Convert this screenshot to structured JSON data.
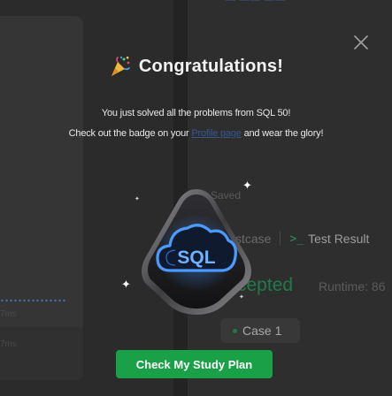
{
  "modal": {
    "title": "Congratulations!",
    "message_line1": "You just solved all the problems from SQL 50!",
    "message_line2_before": "Check out the badge on your",
    "profile_link_text": "Profile page",
    "message_line2_after": "and wear the glory!",
    "badge_text": "SQL",
    "cta_label": "Check My Study Plan",
    "icons": {
      "title_icon": "party-popper-icon",
      "close_icon": "close-icon",
      "badge_icon": "cloud-icon"
    },
    "colors": {
      "cta_background": "#1aa147",
      "badge_accent": "#3f8fff",
      "link": "#3d7be0"
    }
  },
  "background": {
    "saved_label": "Saved",
    "testcase_tab": "stcase",
    "test_result_tab": "Test Result",
    "test_result_icon": "terminal-icon",
    "status_text": "cepted",
    "runtime_label": "Runtime: 86",
    "case_label": "Case 1",
    "ms_label_1": "7ms",
    "ms_label_2": "7ms"
  }
}
